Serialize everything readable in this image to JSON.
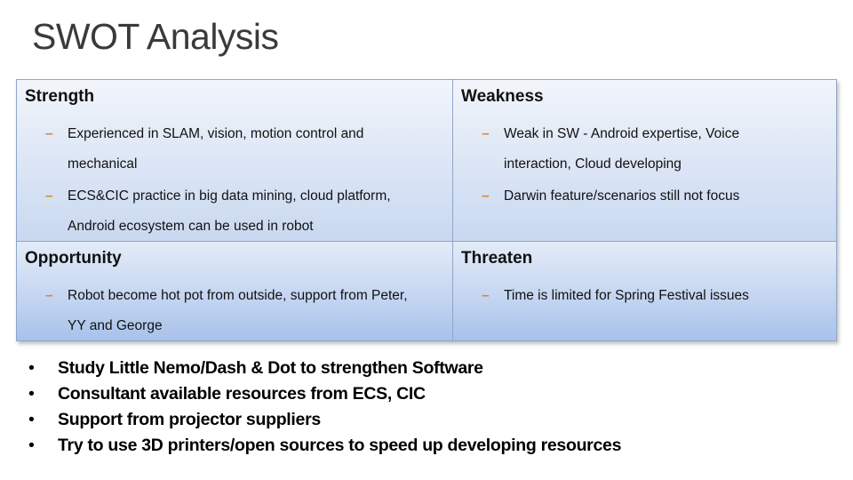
{
  "slide": {
    "title": "SWOT Analysis"
  },
  "swot": {
    "strength": {
      "heading": "Strength",
      "items": [
        "Experienced  in SLAM, vision, motion control and mechanical",
        "ECS&CIC practice in big data mining, cloud platform, Android ecosystem can be used in robot"
      ]
    },
    "weakness": {
      "heading": "Weakness",
      "items": [
        "Weak in SW - Android expertise, Voice interaction, Cloud developing",
        "Darwin feature/scenarios still not focus"
      ]
    },
    "opportunity": {
      "heading": "Opportunity",
      "items": [
        "Robot become hot pot from outside, support from Peter, YY and George"
      ]
    },
    "threaten": {
      "heading": "Threaten",
      "items": [
        "Time is limited for Spring Festival issues"
      ]
    },
    "dash_symbol": "–",
    "dash_color": "#d98a2b"
  },
  "actions": {
    "bullet_symbol": "•",
    "items": [
      "Study Little Nemo/Dash & Dot to strengthen Software",
      "Consultant available resources from ECS, CIC",
      "Support from projector suppliers",
      "Try to use 3D printers/open sources to speed up developing resources"
    ]
  }
}
